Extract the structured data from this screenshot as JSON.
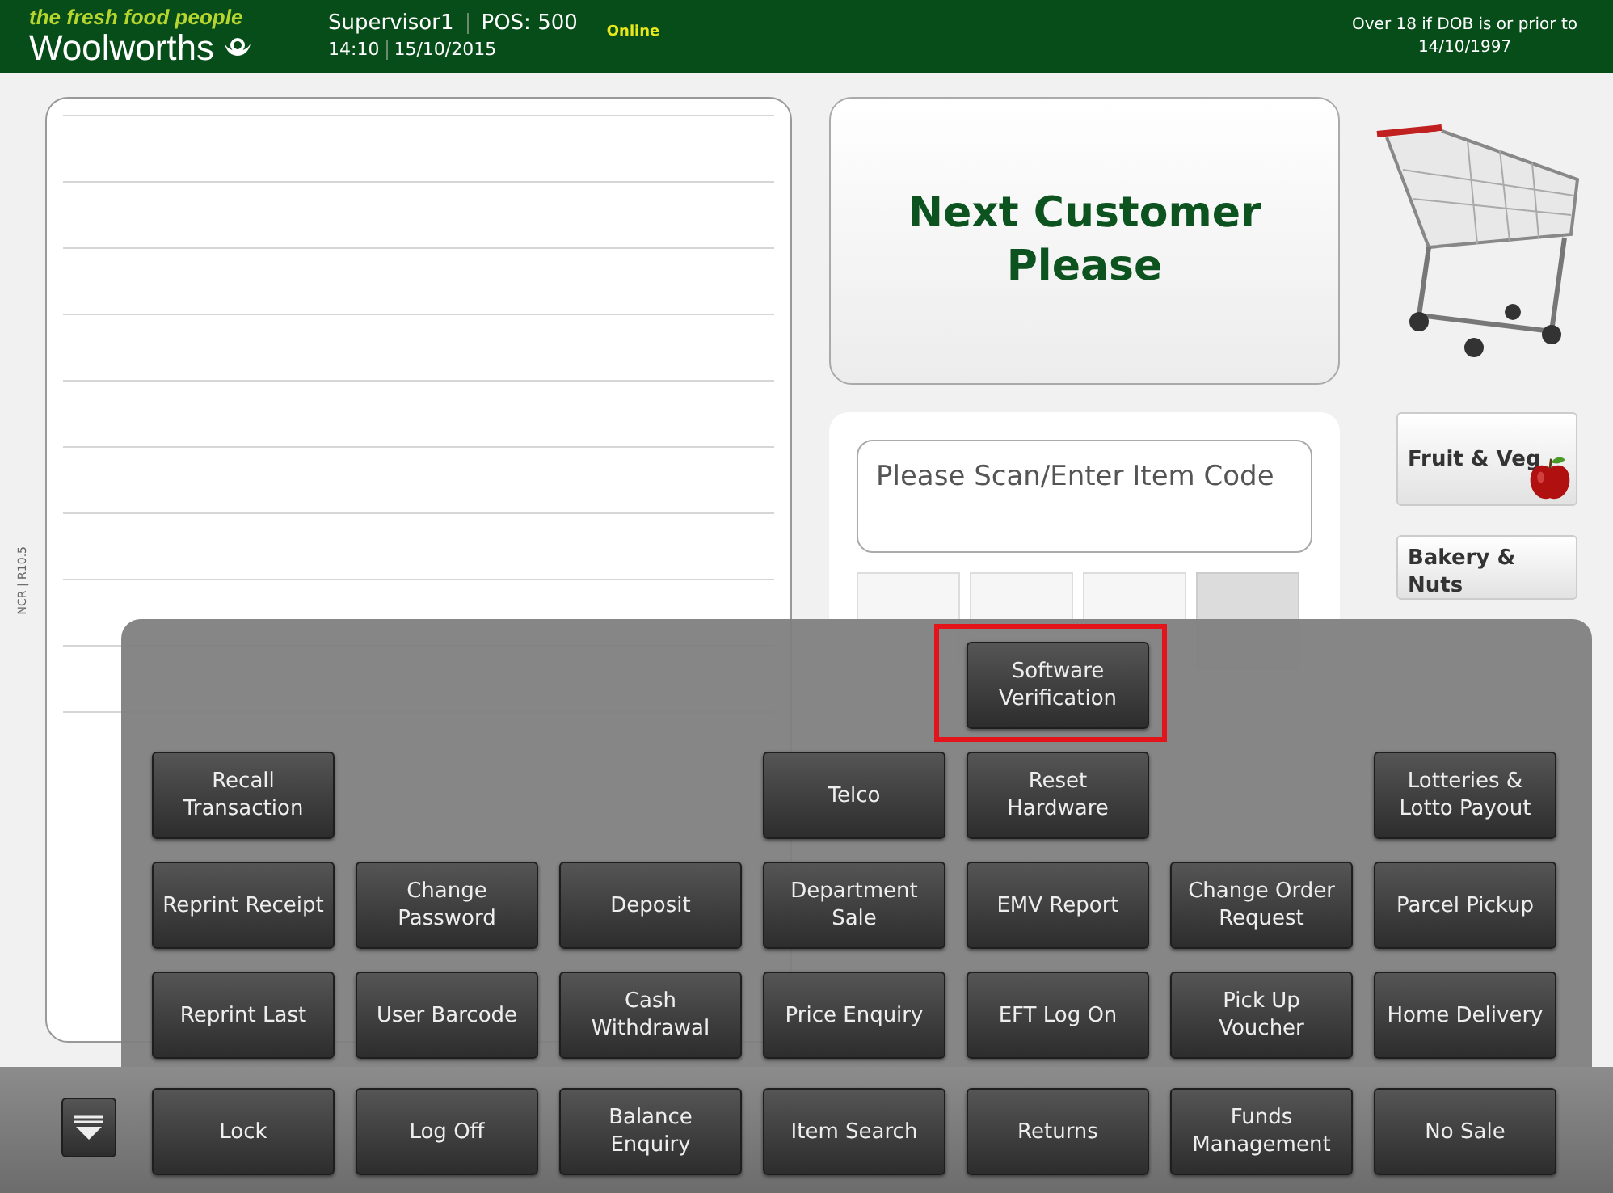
{
  "header": {
    "tagline": "the fresh food people",
    "brand": "Woolworths",
    "user": "Supervisor1",
    "pos": "POS: 500",
    "time": "14:10",
    "date": "15/10/2015",
    "status": "Online",
    "age_notice": [
      "Over 18 if DOB is or prior to",
      "14/10/1997"
    ]
  },
  "version": "NCR | R10.5",
  "customer_message": "Next Customer Please",
  "item_entry": {
    "placeholder": "Please Scan/Enter Item Code"
  },
  "categories": [
    {
      "label": "Fruit & Veg",
      "kind": "fruit"
    },
    {
      "label": "Bakery & Nuts",
      "kind": "plain"
    }
  ],
  "menu": {
    "rows": [
      [
        {
          "kind": "blank"
        },
        {
          "kind": "blank"
        },
        {
          "kind": "blank"
        },
        {
          "kind": "blank"
        },
        {
          "kind": "button",
          "label": "Software Verification",
          "highlighted": true
        },
        {
          "kind": "blank"
        },
        {
          "kind": "blank"
        }
      ],
      [
        {
          "kind": "button",
          "label": "Recall Transaction",
          "highlighted": false
        },
        {
          "kind": "blank"
        },
        {
          "kind": "blank"
        },
        {
          "kind": "button",
          "label": "Telco",
          "highlighted": false
        },
        {
          "kind": "button",
          "label": "Reset Hardware",
          "highlighted": false
        },
        {
          "kind": "blank"
        },
        {
          "kind": "button",
          "label": "Lotteries & Lotto Payout",
          "highlighted": false
        }
      ],
      [
        {
          "kind": "button",
          "label": "Reprint Receipt",
          "highlighted": false
        },
        {
          "kind": "button",
          "label": "Change Password",
          "highlighted": false
        },
        {
          "kind": "button",
          "label": "Deposit",
          "highlighted": false
        },
        {
          "kind": "button",
          "label": "Department Sale",
          "highlighted": false
        },
        {
          "kind": "button",
          "label": "EMV Report",
          "highlighted": false
        },
        {
          "kind": "button",
          "label": "Change Order Request",
          "highlighted": false
        },
        {
          "kind": "button",
          "label": "Parcel Pickup",
          "highlighted": false
        }
      ],
      [
        {
          "kind": "button",
          "label": "Reprint Last",
          "highlighted": false
        },
        {
          "kind": "button",
          "label": "User Barcode",
          "highlighted": false
        },
        {
          "kind": "button",
          "label": "Cash Withdrawal",
          "highlighted": false
        },
        {
          "kind": "button",
          "label": "Price Enquiry",
          "highlighted": false
        },
        {
          "kind": "button",
          "label": "EFT Log On",
          "highlighted": false
        },
        {
          "kind": "button",
          "label": "Pick Up Voucher",
          "highlighted": false
        },
        {
          "kind": "button",
          "label": "Home Delivery",
          "highlighted": false
        }
      ]
    ]
  },
  "bottom_bar": {
    "buttons": [
      {
        "label": "Lock",
        "highlighted": false
      },
      {
        "label": "Log Off",
        "highlighted": false
      },
      {
        "label": "Balance Enquiry",
        "highlighted": false
      },
      {
        "label": "Item Search",
        "highlighted": false
      },
      {
        "label": "Returns",
        "highlighted": false
      },
      {
        "label": "Funds Management",
        "highlighted": false
      },
      {
        "label": "No Sale",
        "highlighted": false
      }
    ]
  }
}
